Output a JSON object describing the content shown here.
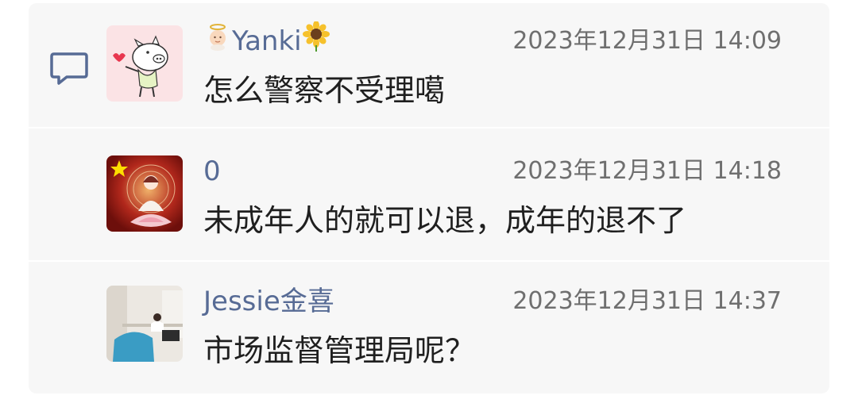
{
  "comments": [
    {
      "name": "Yanki",
      "name_prefix_icon": "angel-baby-emoji",
      "name_suffix_icon": "sunflower-emoji",
      "time": "2023年12月31日 14:09",
      "text": "怎么警察不受理噶",
      "avatar": "cartoon-pig-avatar"
    },
    {
      "name": "0",
      "time": "2023年12月31日 14:18",
      "text": "未成年人的就可以退，成年的退不了",
      "avatar": "flag-lotus-avatar"
    },
    {
      "name": "Jessie金喜",
      "time": "2023年12月31日 14:37",
      "text": "市场监督管理局呢？",
      "avatar": "office-photo-avatar"
    }
  ],
  "comment_icon": "comment-bubble-icon",
  "colors": {
    "name": "#576b95",
    "time": "#6f6f6f",
    "text": "#1f1f1f",
    "panel": "#f7f7f7"
  }
}
